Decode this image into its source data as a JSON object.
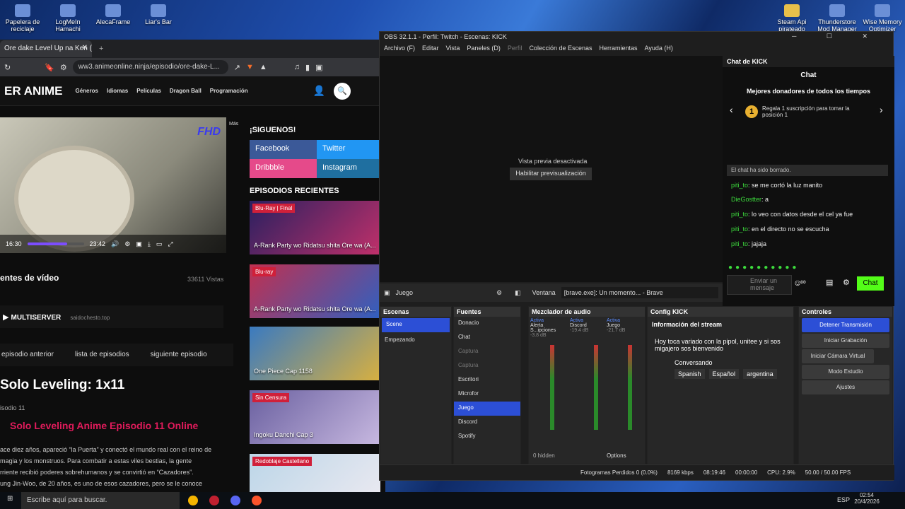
{
  "desktop_icons": [
    {
      "label": "Papelera de reciclaje",
      "icon": "recycle-bin-icon"
    },
    {
      "label": "LogMeIn Hamachi",
      "icon": "hamachi-icon"
    },
    {
      "label": "AlecaFrame",
      "icon": "alecaframe-icon"
    },
    {
      "label": "Liar's Bar",
      "icon": "game-icon"
    },
    {
      "label": "Steam Api pirateado",
      "icon": "folder-icon"
    },
    {
      "label": "Thunderstore Mod Manager",
      "icon": "thunderstore-icon"
    },
    {
      "label": "Wise Memory Optimizer",
      "icon": "wise-icon"
    }
  ],
  "browser": {
    "tab": "Ore dake Level Up na Ken (Sol",
    "url": "ww3.animeonline.ninja/episodio/ore-dake-L...",
    "site": {
      "logo": "ER ANIME",
      "nav": [
        "Géneros",
        "Idiomas",
        "Películas",
        "Dragon Ball",
        "Programación"
      ],
      "mas": "Más",
      "player": {
        "fhd": "FHD",
        "current": "16:30",
        "duration": "23:42",
        "progress": 0.7
      },
      "video_title": "entes de vídeo",
      "views": "33611 Vistas",
      "server": "MULTISERVER",
      "server_host": "saidochesto.top",
      "nav_ep": {
        "prev": "episodio anterior",
        "list": "lista de episodios",
        "next": "siguiente episodio"
      },
      "title": "Solo Leveling: 1x11",
      "ep": "isodio 11",
      "subtitle": "Solo Leveling Anime Episodio 11 Online",
      "desc": [
        "ace diez años, apareció “la Puerta” y conectó el mundo real con el reino de",
        "magia y los monstruos. Para combatir a estas viles bestias, la gente",
        "rriente recibió poderes sobrehumanos y se convirtió en “Cazadores”.",
        "ung Jin-Woo, de 20 años, es uno de esos cazadores, pero se le conoce"
      ],
      "follow": "¡SIGUENOS!",
      "social": [
        "Facebook",
        "Twitter",
        "Dribbble",
        "Instagram"
      ],
      "recent": "EPISODIOS RECIENTES",
      "episodes": [
        {
          "tag": "Blu-Ray | Final",
          "title": "A-Rank Party wo Ridatsu shita Ore wa (A..."
        },
        {
          "tag": "Blu-ray",
          "title": "A-Rank Party wo Ridatsu shita Ore wa (A..."
        },
        {
          "tag": "",
          "title": "One Piece Cap 1158"
        },
        {
          "tag": "Sin Censura",
          "title": "Ingoku Danchi Cap 3"
        },
        {
          "tag": "Redoblaje Castellano",
          "title": ""
        }
      ]
    }
  },
  "obs": {
    "title": "OBS 32.1.1 - Perfil: Twitch - Escenas: KICK",
    "menu": [
      "Archivo (F)",
      "Editar",
      "Vista",
      "Paneles (D)",
      "Perfil",
      "Colección de Escenas",
      "Herramientas",
      "Ayuda (H)"
    ],
    "preview_off": "Vista previa desactivada",
    "enable_preview": "Habilitar previsualización",
    "source_bar": {
      "name": "Juego",
      "window_label": "Ventana",
      "window_value": "[brave.exe]: Un momento... - Brave"
    },
    "chat": {
      "dock_title": "Chat de KICK",
      "header": "Chat",
      "donors": "Mejores donadores de todos los tiempos",
      "gift": "Regala 1 suscripción para tomar la posición 1",
      "cleared": "El chat ha sido borrado.",
      "messages": [
        {
          "user": "piti_to",
          "text": "se me cortó la luz manito"
        },
        {
          "user": "DieGostter",
          "text": "a"
        },
        {
          "user": "piti_to",
          "text": "lo veo con datos desde el cel ya fue"
        },
        {
          "user": "piti_to",
          "text": "en el directo no se escucha"
        },
        {
          "user": "piti_to",
          "text": "jajaja"
        }
      ],
      "placeholder": "Enviar un mensaje",
      "send": "Chat"
    },
    "scenes": {
      "title": "Escenas",
      "items": [
        "Scene",
        "Empezando"
      ]
    },
    "sources": {
      "title": "Fuentes",
      "items": [
        "Donacio",
        "Chat",
        "Captura",
        "Captura",
        "Escritori",
        "Microfor",
        "Juego",
        "Discord",
        "Spotify"
      ]
    },
    "mixer": {
      "title": "Mezclador de audio",
      "active": "Activa",
      "hidden": "0 hidden",
      "channels": [
        {
          "name": "Alerta S...ipciones",
          "db": "-3.8 dB"
        },
        {
          "name": "Discord",
          "db": "-19.4 dB"
        },
        {
          "name": "Juego",
          "db": "-21.7 dB"
        }
      ],
      "options": "Options"
    },
    "kick": {
      "title": "Config KICK",
      "info": "Información del stream",
      "stream_title": "Hoy toca variado con la pipol, unitee y si sos migajero sos bienvenido",
      "category": "Conversando",
      "tags": [
        "Spanish",
        "Español",
        "argentina"
      ]
    },
    "controls": {
      "title": "Controles",
      "buttons": [
        "Detener Transmisión",
        "Iniciar Grabación",
        "Iniciar Cámara Virtual",
        "Modo Estudio",
        "Ajustes"
      ]
    },
    "status": {
      "dropped": "Fotogramas Perdidos 0 (0.0%)",
      "kbps": "8169 kbps",
      "live": "08:19:46",
      "rec": "00:00:00",
      "cpu": "CPU: 2.9%",
      "fps": "50.00 / 50.00 FPS"
    }
  },
  "taskbar": {
    "search": "Escribe aquí para buscar.",
    "lang": "ESP",
    "time": "02:54",
    "date": "20/4/2026"
  }
}
